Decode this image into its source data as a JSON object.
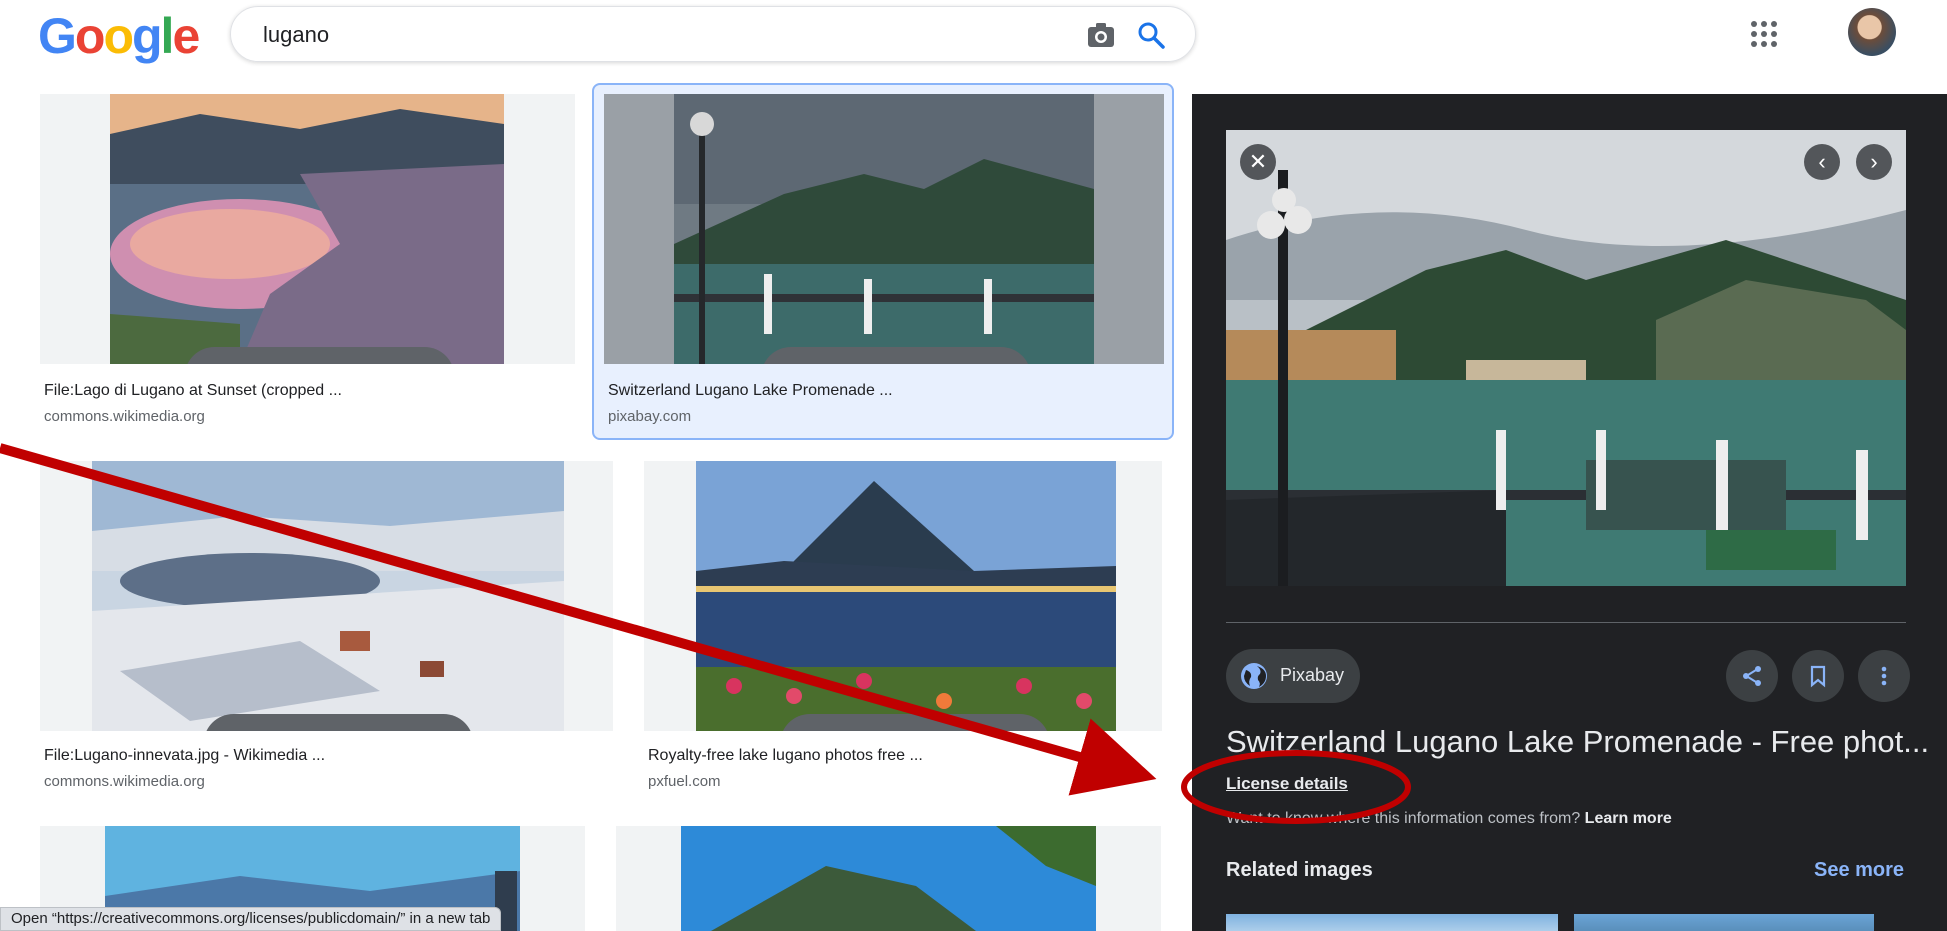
{
  "header": {
    "logo_letters": [
      "G",
      "o",
      "o",
      "g",
      "l",
      "e"
    ],
    "logo_colors": [
      "#4285F4",
      "#EA4335",
      "#FBBC05",
      "#4285F4",
      "#34A853",
      "#EA4335"
    ],
    "search_value": "lugano"
  },
  "results": [
    {
      "title": "File:Lago di Lugano at Sunset (cropped ...",
      "source": "commons.wikimedia.org"
    },
    {
      "title": "Switzerland Lugano Lake Promenade ...",
      "source": "pixabay.com"
    },
    {
      "title": "File:Lugano-innevata.jpg - Wikimedia ...",
      "source": "commons.wikimedia.org"
    },
    {
      "title": "Royalty-free lake lugano photos free ...",
      "source": "pxfuel.com"
    }
  ],
  "panel": {
    "source_name": "Pixabay",
    "title": "Switzerland Lugano Lake Promenade - Free phot...",
    "license_label": "License details",
    "info_text": "Want to know where this information comes from?",
    "learn_more": "Learn more",
    "related_heading": "Related images",
    "see_more": "See more"
  },
  "status_bar": "Open “https://creativecommons.org/licenses/publicdomain/” in a new tab",
  "colors": {
    "accent_blue": "#1a73e8",
    "panel_bg": "#202124",
    "annotation_red": "#c00000",
    "selected_outline": "#8ab4f8"
  },
  "icons": [
    "camera-icon",
    "search-icon",
    "apps-grid-icon",
    "image-type-icon",
    "close-icon",
    "chevron-left-icon",
    "chevron-right-icon",
    "globe-icon",
    "share-icon",
    "bookmark-icon",
    "more-vert-icon"
  ]
}
